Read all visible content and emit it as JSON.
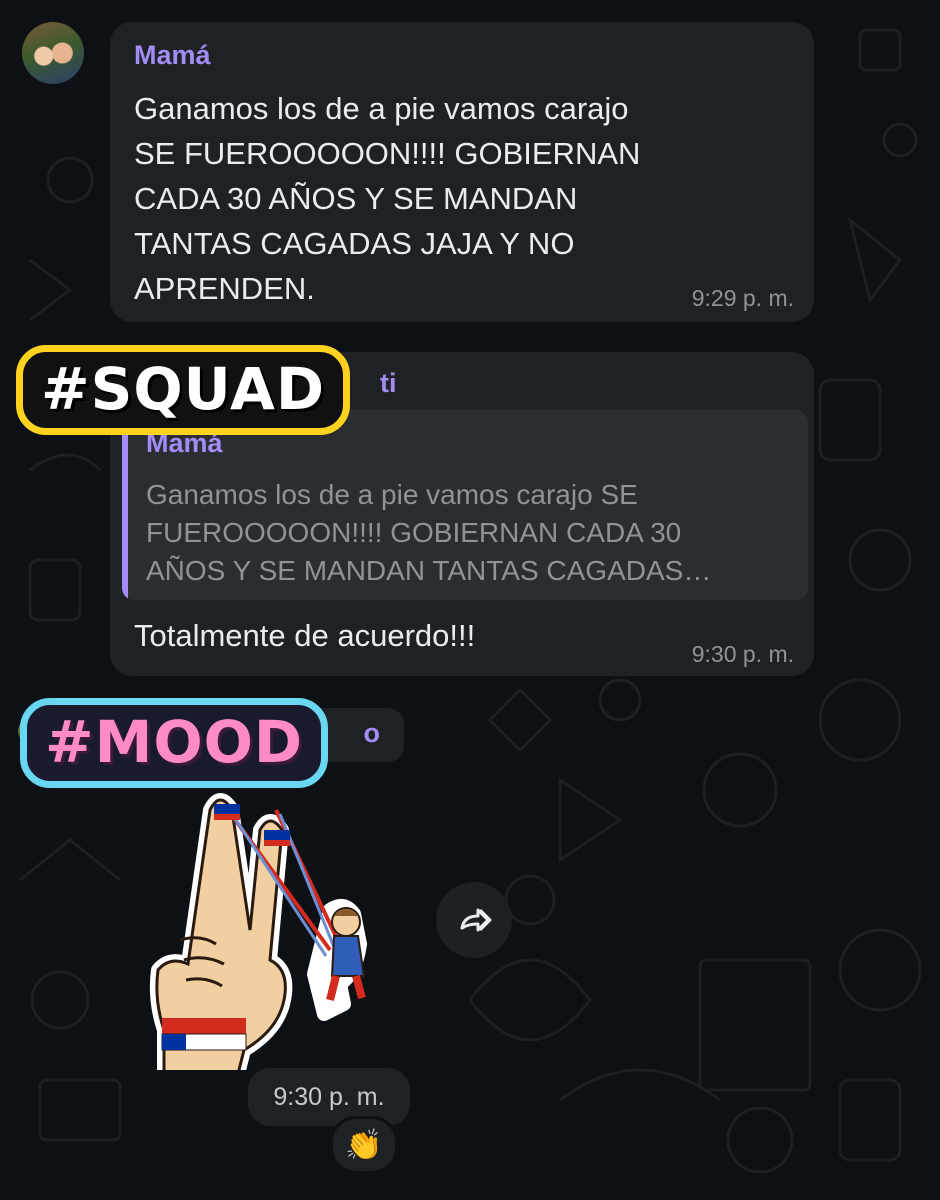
{
  "messages": [
    {
      "sender": "Mamá",
      "text": "Ganamos los de a pie vamos carajo\nSE FUEROOOOON!!!! GOBIERNAN\nCADA 30 AÑOS Y SE MANDAN\nTANTAS CAGADAS JAJA Y NO\nAPRENDEN.",
      "time": "9:29 p. m."
    },
    {
      "sender_partial": "ti",
      "quote": {
        "sender": "Mamá",
        "text": "Ganamos los de a pie vamos carajo SE\nFUEROOOOON!!!! GOBIERNAN CADA 30\nAÑOS Y SE MANDAN TANTAS CAGADAS…"
      },
      "text": "Totalmente de acuerdo!!!",
      "time": "9:30 p. m."
    },
    {
      "sender_partial": "o",
      "sticker": "victory-hand-slingshot-sticker",
      "time": "9:30 p. m.",
      "reaction": "👏"
    }
  ],
  "overlays": {
    "squad": "#SQUAD",
    "mood": "#MOOD"
  },
  "icons": {
    "forward": "forward-arrow-icon"
  },
  "colors": {
    "background": "#0d1014",
    "bubble": "#1f2225",
    "sender": "#a38cf5",
    "time": "#8d9599",
    "squad_border": "#ffd21f",
    "mood_text": "#ff8bc4",
    "mood_border": "#6ad7f2"
  }
}
